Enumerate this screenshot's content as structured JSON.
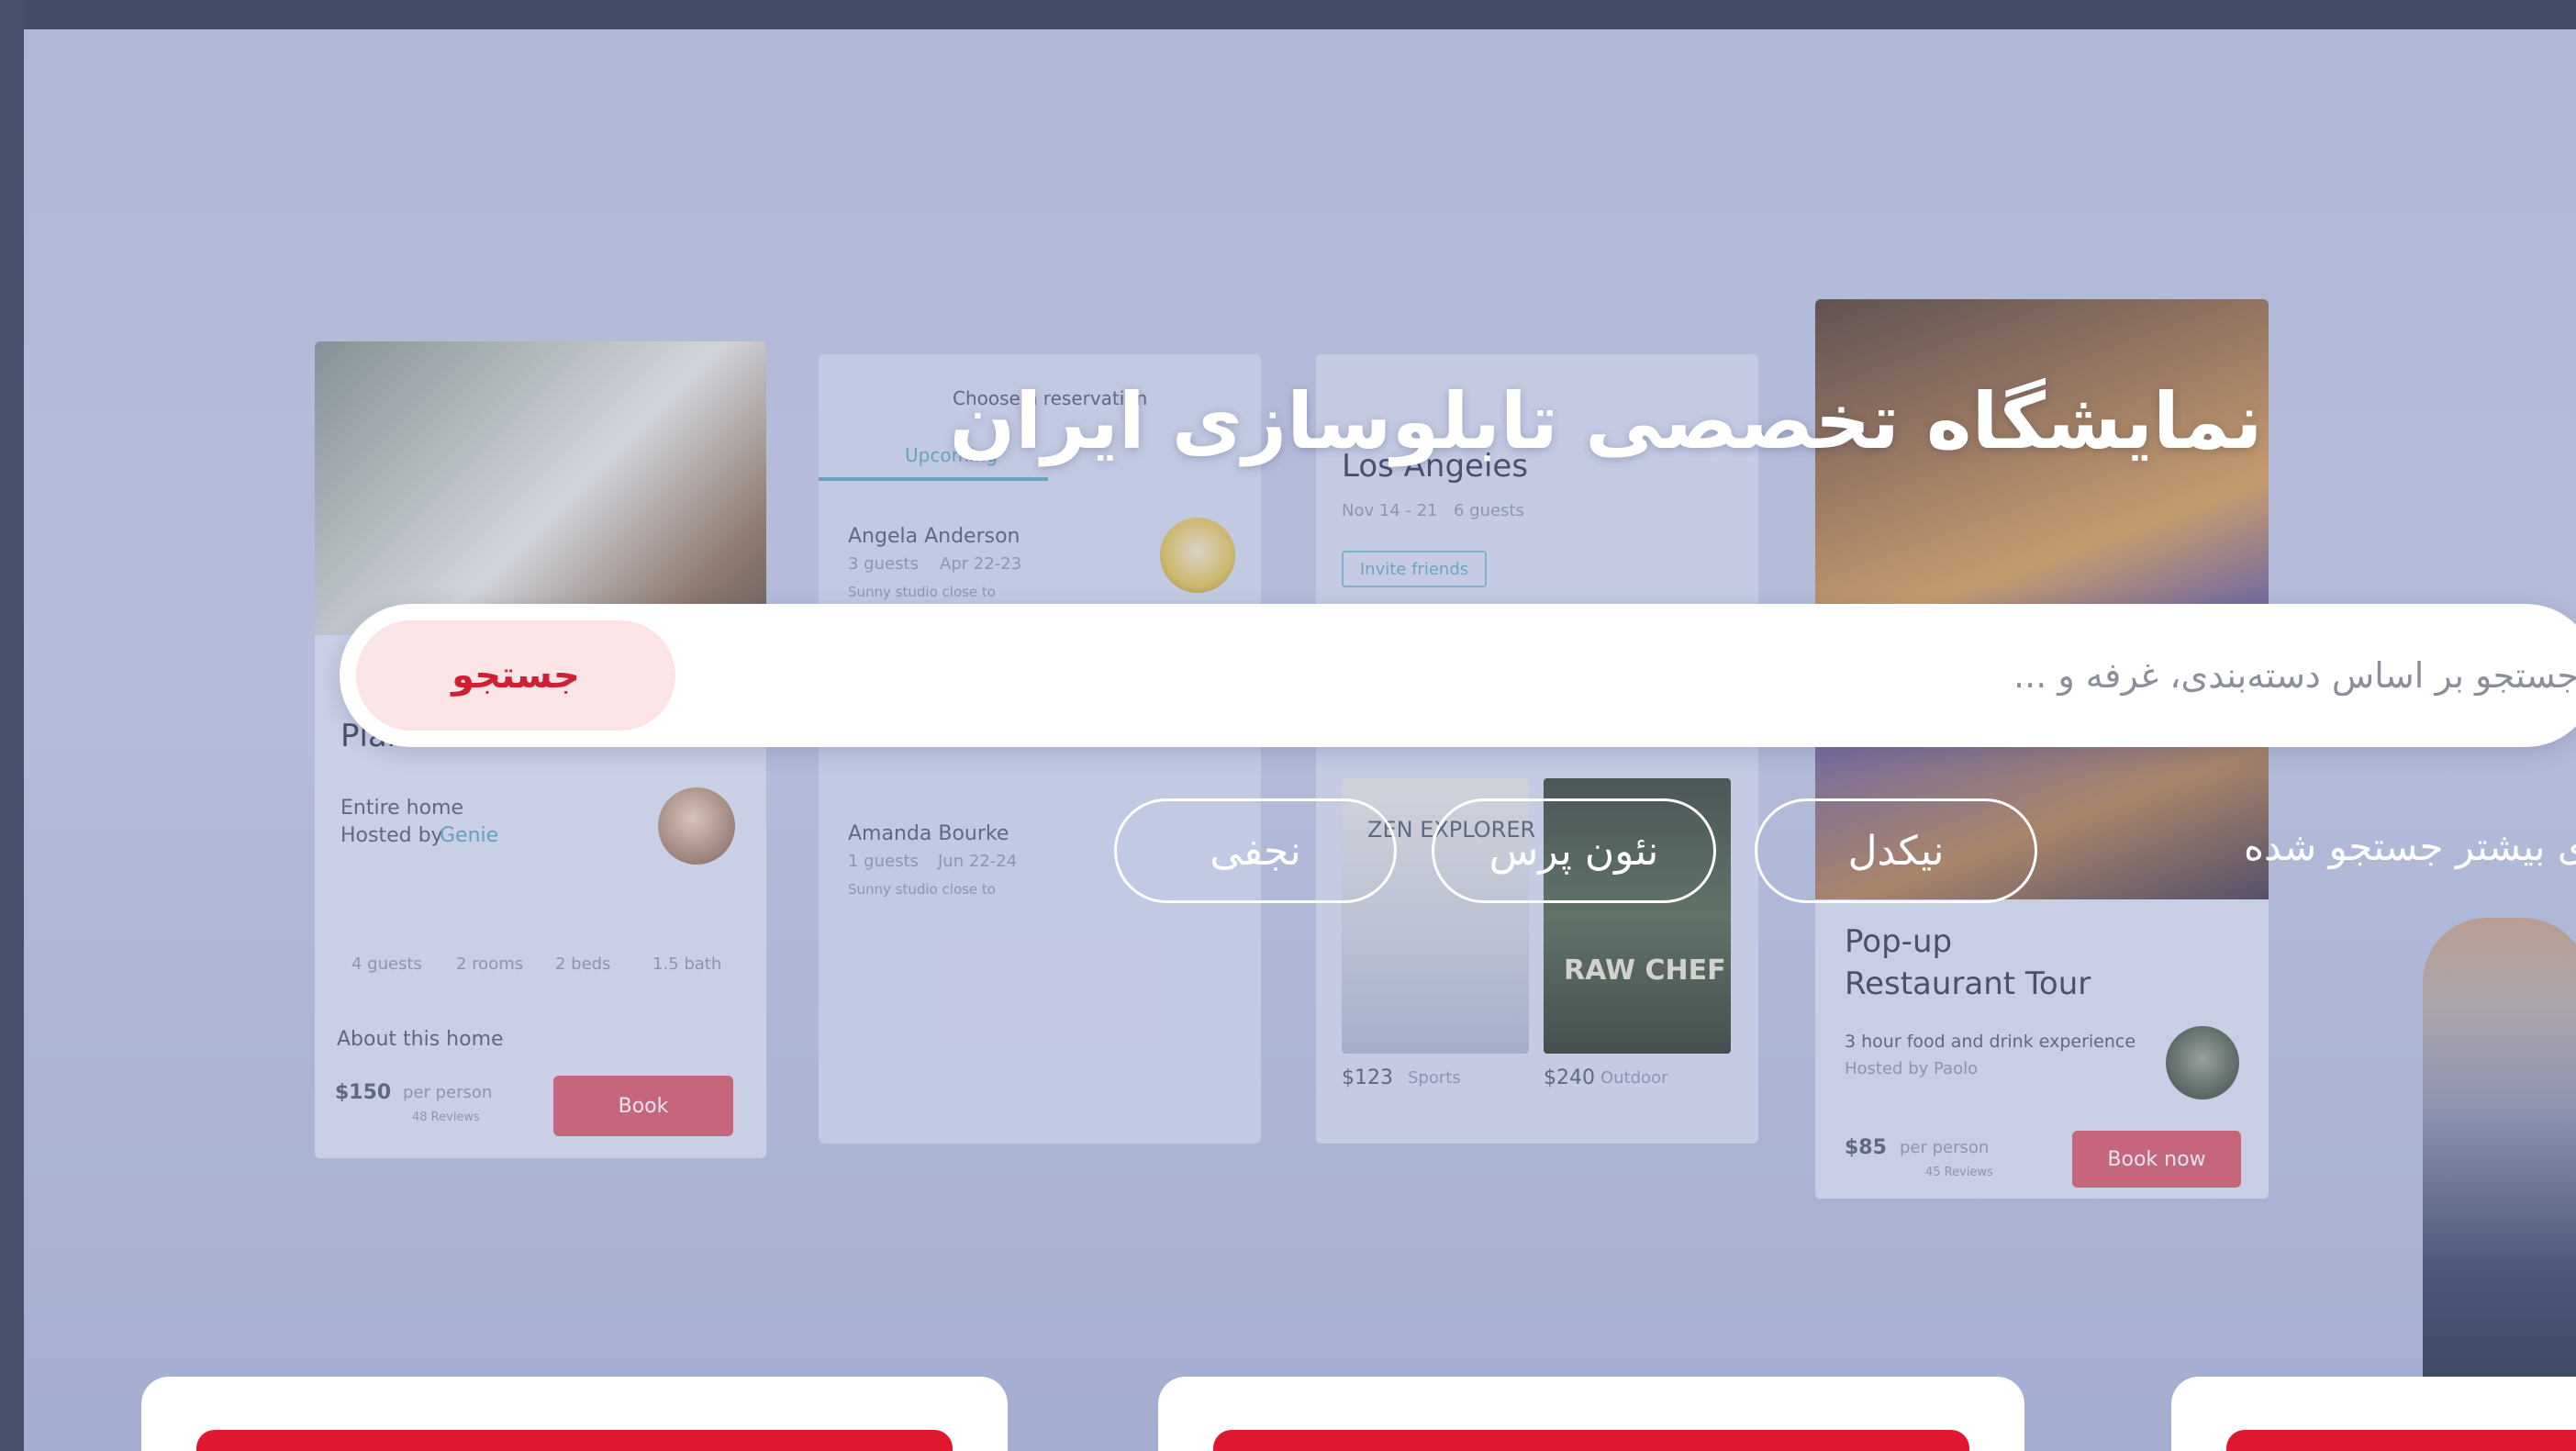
{
  "hero": {
    "title": "نمایشگاه تخصصی تابلوسازی ایران",
    "background_screens": {
      "home_card": {
        "title": "Plan and Kitchen",
        "type": "Entire home",
        "hosted_by_label": "Hosted by",
        "host": "Genie",
        "amenities": [
          "4 guests",
          "2 rooms",
          "2 beds",
          "1.5 bath"
        ],
        "about": "About this home",
        "price": "$150",
        "price_unit": "per person",
        "reviews": "48 Reviews",
        "book_label": "Book"
      },
      "reservation_card": {
        "header": "Choose a reservation",
        "tab": "Upcoming",
        "entries": [
          {
            "name": "Angela Anderson",
            "guests": "3 guests",
            "dates": "Apr 22-23",
            "note": "Sunny studio close to"
          },
          {
            "name": "Amanda Bourke",
            "guests": "1 guests",
            "dates": "Jun 22-24",
            "note": "Sunny studio close to"
          }
        ]
      },
      "trip_card": {
        "city": "Los Angeles",
        "dates": "Nov 14 - 21",
        "guests": "6 guests",
        "invite_label": "Invite friends",
        "book_one_title": "ZEN EXPLORER",
        "book_two_title": "RAW CHEF",
        "price_one": "$123",
        "cat_one": "Sports",
        "price_two": "$240",
        "cat_two": "Outdoor"
      },
      "tour_card": {
        "title_line1": "Pop-up",
        "title_line2": "Restaurant Tour",
        "desc": "3 hour food and drink experience",
        "hosted_by": "Hosted by Paolo",
        "price": "$85",
        "price_unit": "per person",
        "reviews": "45 Reviews",
        "book_label": "Book now"
      }
    }
  },
  "search": {
    "placeholder": "جستجو بر اساس دسته‌بندی، غرفه و ...",
    "button_label": "جستجو"
  },
  "popular": {
    "label": "ه های بیشتر جستجو شده",
    "items": [
      "نیکدل",
      "نئون پرس",
      "نجفی"
    ]
  },
  "colors": {
    "accent": "#d01e33",
    "search_button_bg": "#fbe4e6",
    "panel_bar": "#e0182f"
  }
}
